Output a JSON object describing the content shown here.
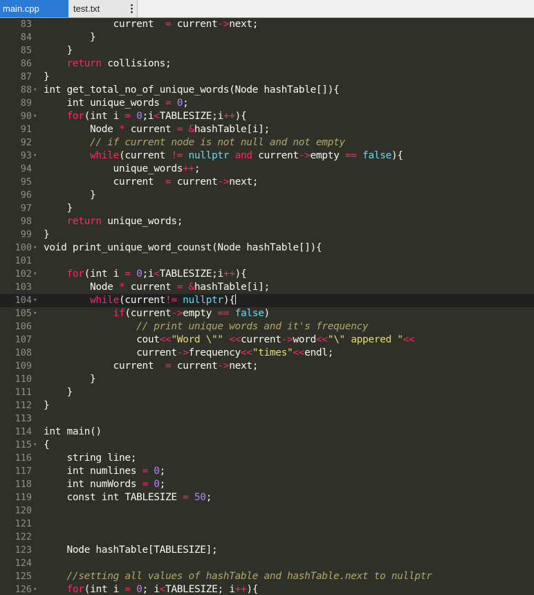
{
  "tabs": [
    {
      "label": "main.cpp",
      "active": true
    },
    {
      "label": "test.txt",
      "active": false
    }
  ],
  "theme": {
    "background": "#2f3129",
    "active_line": "#202020",
    "tab_active": "#2b7bd6"
  },
  "active_line": 104,
  "editor": {
    "lines": [
      {
        "n": "83",
        "f": false,
        "tokens": [
          [
            "            current  ",
            "p"
          ],
          [
            "=",
            "o"
          ],
          [
            " current",
            "p"
          ],
          [
            "->",
            "o"
          ],
          [
            "next;",
            "p"
          ]
        ]
      },
      {
        "n": "84",
        "f": false,
        "tokens": [
          [
            "        }",
            "p"
          ]
        ]
      },
      {
        "n": "85",
        "f": false,
        "tokens": [
          [
            "    }",
            "p"
          ]
        ]
      },
      {
        "n": "86",
        "f": false,
        "tokens": [
          [
            "    ",
            "p"
          ],
          [
            "return",
            "ctl"
          ],
          [
            " collisions;",
            "p"
          ]
        ]
      },
      {
        "n": "87",
        "f": false,
        "tokens": [
          [
            "}",
            "p"
          ]
        ]
      },
      {
        "n": "88",
        "f": true,
        "tokens": [
          [
            "int",
            "k"
          ],
          [
            " get_total_no_of_unique_words(Node hashTable[]){",
            "p"
          ]
        ]
      },
      {
        "n": "89",
        "f": false,
        "tokens": [
          [
            "    ",
            "p"
          ],
          [
            "int",
            "k"
          ],
          [
            " unique_words ",
            "p"
          ],
          [
            "=",
            "o"
          ],
          [
            " ",
            "p"
          ],
          [
            "0",
            "n"
          ],
          [
            ";",
            "p"
          ]
        ]
      },
      {
        "n": "90",
        "f": true,
        "tokens": [
          [
            "    ",
            "p"
          ],
          [
            "for",
            "ctl"
          ],
          [
            "(",
            "p"
          ],
          [
            "int",
            "k"
          ],
          [
            " i ",
            "p"
          ],
          [
            "=",
            "o"
          ],
          [
            " ",
            "p"
          ],
          [
            "0",
            "n"
          ],
          [
            ";i",
            "p"
          ],
          [
            "<",
            "o"
          ],
          [
            "TABLESIZE;i",
            "p"
          ],
          [
            "++",
            "o"
          ],
          [
            "){",
            "p"
          ]
        ]
      },
      {
        "n": "91",
        "f": false,
        "tokens": [
          [
            "        Node ",
            "p"
          ],
          [
            "*",
            "o"
          ],
          [
            " current ",
            "p"
          ],
          [
            "=",
            "o"
          ],
          [
            " ",
            "p"
          ],
          [
            "&",
            "o"
          ],
          [
            "hashTable[i];",
            "p"
          ]
        ]
      },
      {
        "n": "92",
        "f": false,
        "tokens": [
          [
            "        ",
            "p"
          ],
          [
            "// if current node is not null and not empty",
            "c"
          ]
        ]
      },
      {
        "n": "93",
        "f": true,
        "tokens": [
          [
            "        ",
            "p"
          ],
          [
            "while",
            "ctl"
          ],
          [
            "(current ",
            "p"
          ],
          [
            "!=",
            "o"
          ],
          [
            " ",
            "p"
          ],
          [
            "nullptr",
            "b"
          ],
          [
            " ",
            "p"
          ],
          [
            "and",
            "o"
          ],
          [
            " current",
            "p"
          ],
          [
            "->",
            "o"
          ],
          [
            "empty ",
            "p"
          ],
          [
            "==",
            "o"
          ],
          [
            " ",
            "p"
          ],
          [
            "false",
            "b"
          ],
          [
            "){",
            "p"
          ]
        ]
      },
      {
        "n": "94",
        "f": false,
        "tokens": [
          [
            "            unique_words",
            "p"
          ],
          [
            "++",
            "o"
          ],
          [
            ";",
            "p"
          ]
        ]
      },
      {
        "n": "95",
        "f": false,
        "tokens": [
          [
            "            current  ",
            "p"
          ],
          [
            "=",
            "o"
          ],
          [
            " current",
            "p"
          ],
          [
            "->",
            "o"
          ],
          [
            "next;",
            "p"
          ]
        ]
      },
      {
        "n": "96",
        "f": false,
        "tokens": [
          [
            "        }",
            "p"
          ]
        ]
      },
      {
        "n": "97",
        "f": false,
        "tokens": [
          [
            "    }",
            "p"
          ]
        ]
      },
      {
        "n": "98",
        "f": false,
        "tokens": [
          [
            "    ",
            "p"
          ],
          [
            "return",
            "ctl"
          ],
          [
            " unique_words;",
            "p"
          ]
        ]
      },
      {
        "n": "99",
        "f": false,
        "tokens": [
          [
            "}",
            "p"
          ]
        ]
      },
      {
        "n": "100",
        "f": true,
        "tokens": [
          [
            "void",
            "k"
          ],
          [
            " print_unique_word_counst(Node hashTable[]){",
            "p"
          ]
        ]
      },
      {
        "n": "101",
        "f": false,
        "tokens": []
      },
      {
        "n": "102",
        "f": true,
        "tokens": [
          [
            "    ",
            "p"
          ],
          [
            "for",
            "ctl"
          ],
          [
            "(",
            "p"
          ],
          [
            "int",
            "k"
          ],
          [
            " i ",
            "p"
          ],
          [
            "=",
            "o"
          ],
          [
            " ",
            "p"
          ],
          [
            "0",
            "n"
          ],
          [
            ";i",
            "p"
          ],
          [
            "<",
            "o"
          ],
          [
            "TABLESIZE;i",
            "p"
          ],
          [
            "++",
            "o"
          ],
          [
            "){",
            "p"
          ]
        ]
      },
      {
        "n": "103",
        "f": false,
        "tokens": [
          [
            "        Node ",
            "p"
          ],
          [
            "*",
            "o"
          ],
          [
            " current ",
            "p"
          ],
          [
            "=",
            "o"
          ],
          [
            " ",
            "p"
          ],
          [
            "&",
            "o"
          ],
          [
            "hashTable[i];",
            "p"
          ]
        ]
      },
      {
        "n": "104",
        "f": true,
        "tokens": [
          [
            "        ",
            "p"
          ],
          [
            "while",
            "ctl"
          ],
          [
            "(current",
            "p"
          ],
          [
            "!=",
            "o"
          ],
          [
            " ",
            "p"
          ],
          [
            "nullptr",
            "b"
          ],
          [
            "){",
            "p"
          ]
        ]
      },
      {
        "n": "105",
        "f": true,
        "tokens": [
          [
            "            ",
            "p"
          ],
          [
            "if",
            "ctl"
          ],
          [
            "(current",
            "p"
          ],
          [
            "->",
            "o"
          ],
          [
            "empty ",
            "p"
          ],
          [
            "==",
            "o"
          ],
          [
            " ",
            "p"
          ],
          [
            "false",
            "b"
          ],
          [
            ")",
            "p"
          ]
        ]
      },
      {
        "n": "106",
        "f": false,
        "tokens": [
          [
            "                ",
            "p"
          ],
          [
            "// print unique words and it's frequency",
            "c"
          ]
        ]
      },
      {
        "n": "107",
        "f": false,
        "tokens": [
          [
            "                cout",
            "p"
          ],
          [
            "<<",
            "o"
          ],
          [
            "\"Word \\\"\"",
            "s"
          ],
          [
            " ",
            "p"
          ],
          [
            "<<",
            "o"
          ],
          [
            "current",
            "p"
          ],
          [
            "->",
            "o"
          ],
          [
            "word",
            "p"
          ],
          [
            "<<",
            "o"
          ],
          [
            "\"\\\" appered \"",
            "s"
          ],
          [
            "<<",
            "o"
          ]
        ]
      },
      {
        "n": "108",
        "f": false,
        "tokens": [
          [
            "                current",
            "p"
          ],
          [
            "->",
            "o"
          ],
          [
            "frequency",
            "p"
          ],
          [
            "<<",
            "o"
          ],
          [
            "\"times\"",
            "s"
          ],
          [
            "<<",
            "o"
          ],
          [
            "endl;",
            "p"
          ]
        ]
      },
      {
        "n": "109",
        "f": false,
        "tokens": [
          [
            "            current  ",
            "p"
          ],
          [
            "=",
            "o"
          ],
          [
            " current",
            "p"
          ],
          [
            "->",
            "o"
          ],
          [
            "next;",
            "p"
          ]
        ]
      },
      {
        "n": "110",
        "f": false,
        "tokens": [
          [
            "        }",
            "p"
          ]
        ]
      },
      {
        "n": "111",
        "f": false,
        "tokens": [
          [
            "    }",
            "p"
          ]
        ]
      },
      {
        "n": "112",
        "f": false,
        "tokens": [
          [
            "}",
            "p"
          ]
        ]
      },
      {
        "n": "113",
        "f": false,
        "tokens": []
      },
      {
        "n": "114",
        "f": false,
        "tokens": [
          [
            "int",
            "k"
          ],
          [
            " main()",
            "p"
          ]
        ]
      },
      {
        "n": "115",
        "f": true,
        "tokens": [
          [
            "{",
            "p"
          ]
        ]
      },
      {
        "n": "116",
        "f": false,
        "tokens": [
          [
            "    ",
            "p"
          ],
          [
            "string",
            "k"
          ],
          [
            " line;",
            "p"
          ]
        ]
      },
      {
        "n": "117",
        "f": false,
        "tokens": [
          [
            "    ",
            "p"
          ],
          [
            "int",
            "k"
          ],
          [
            " numlines ",
            "p"
          ],
          [
            "=",
            "o"
          ],
          [
            " ",
            "p"
          ],
          [
            "0",
            "n"
          ],
          [
            ";",
            "p"
          ]
        ]
      },
      {
        "n": "118",
        "f": false,
        "tokens": [
          [
            "    ",
            "p"
          ],
          [
            "int",
            "k"
          ],
          [
            " numWords ",
            "p"
          ],
          [
            "=",
            "o"
          ],
          [
            " ",
            "p"
          ],
          [
            "0",
            "n"
          ],
          [
            ";",
            "p"
          ]
        ]
      },
      {
        "n": "119",
        "f": false,
        "tokens": [
          [
            "    ",
            "p"
          ],
          [
            "const int",
            "k"
          ],
          [
            " TABLESIZE ",
            "p"
          ],
          [
            "=",
            "o"
          ],
          [
            " ",
            "p"
          ],
          [
            "50",
            "n"
          ],
          [
            ";",
            "p"
          ]
        ]
      },
      {
        "n": "120",
        "f": false,
        "tokens": []
      },
      {
        "n": "121",
        "f": false,
        "tokens": []
      },
      {
        "n": "122",
        "f": false,
        "tokens": []
      },
      {
        "n": "123",
        "f": false,
        "tokens": [
          [
            "    Node hashTable[TABLESIZE];",
            "p"
          ]
        ]
      },
      {
        "n": "124",
        "f": false,
        "tokens": []
      },
      {
        "n": "125",
        "f": false,
        "tokens": [
          [
            "    ",
            "p"
          ],
          [
            "//setting all values of hashTable and hashTable.next to nullptr",
            "c"
          ]
        ]
      },
      {
        "n": "126",
        "f": true,
        "tokens": [
          [
            "    ",
            "p"
          ],
          [
            "for",
            "ctl"
          ],
          [
            "(",
            "p"
          ],
          [
            "int",
            "k"
          ],
          [
            " i ",
            "p"
          ],
          [
            "=",
            "o"
          ],
          [
            " ",
            "p"
          ],
          [
            "0",
            "n"
          ],
          [
            "; i",
            "p"
          ],
          [
            "<",
            "o"
          ],
          [
            "TABLESIZE; i",
            "p"
          ],
          [
            "++",
            "o"
          ],
          [
            "){",
            "p"
          ]
        ]
      }
    ]
  }
}
